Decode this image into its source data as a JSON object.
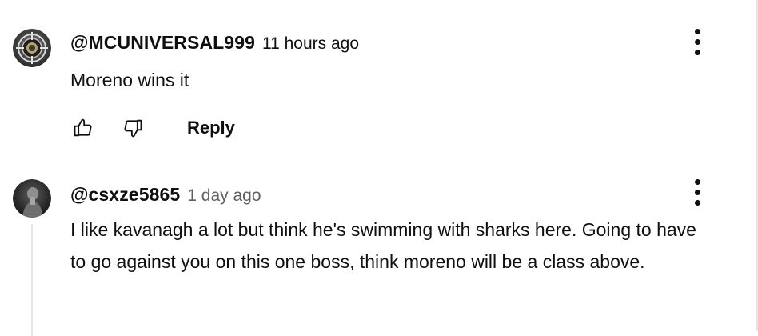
{
  "comments": [
    {
      "author": "@MCUNIVERSAL999",
      "timestamp": "11 hours ago",
      "text": "Moreno wins it",
      "reply_label": "Reply",
      "avatar_icon": "crosshair-logo-avatar"
    },
    {
      "author": "@csxze5865",
      "timestamp": "1 day ago",
      "text": "I like kavanagh a lot but think he's swimming with sharks here. Going to have to go against you on this one boss, think moreno will be a class above.",
      "avatar_icon": "dark-photo-avatar"
    }
  ],
  "icons": {
    "like": "thumbs-up-icon",
    "dislike": "thumbs-down-icon",
    "menu": "more-vert-icon"
  },
  "colors": {
    "text": "#0f0f0f",
    "secondary_text": "#606060",
    "thread_line": "#e5e5e5"
  }
}
